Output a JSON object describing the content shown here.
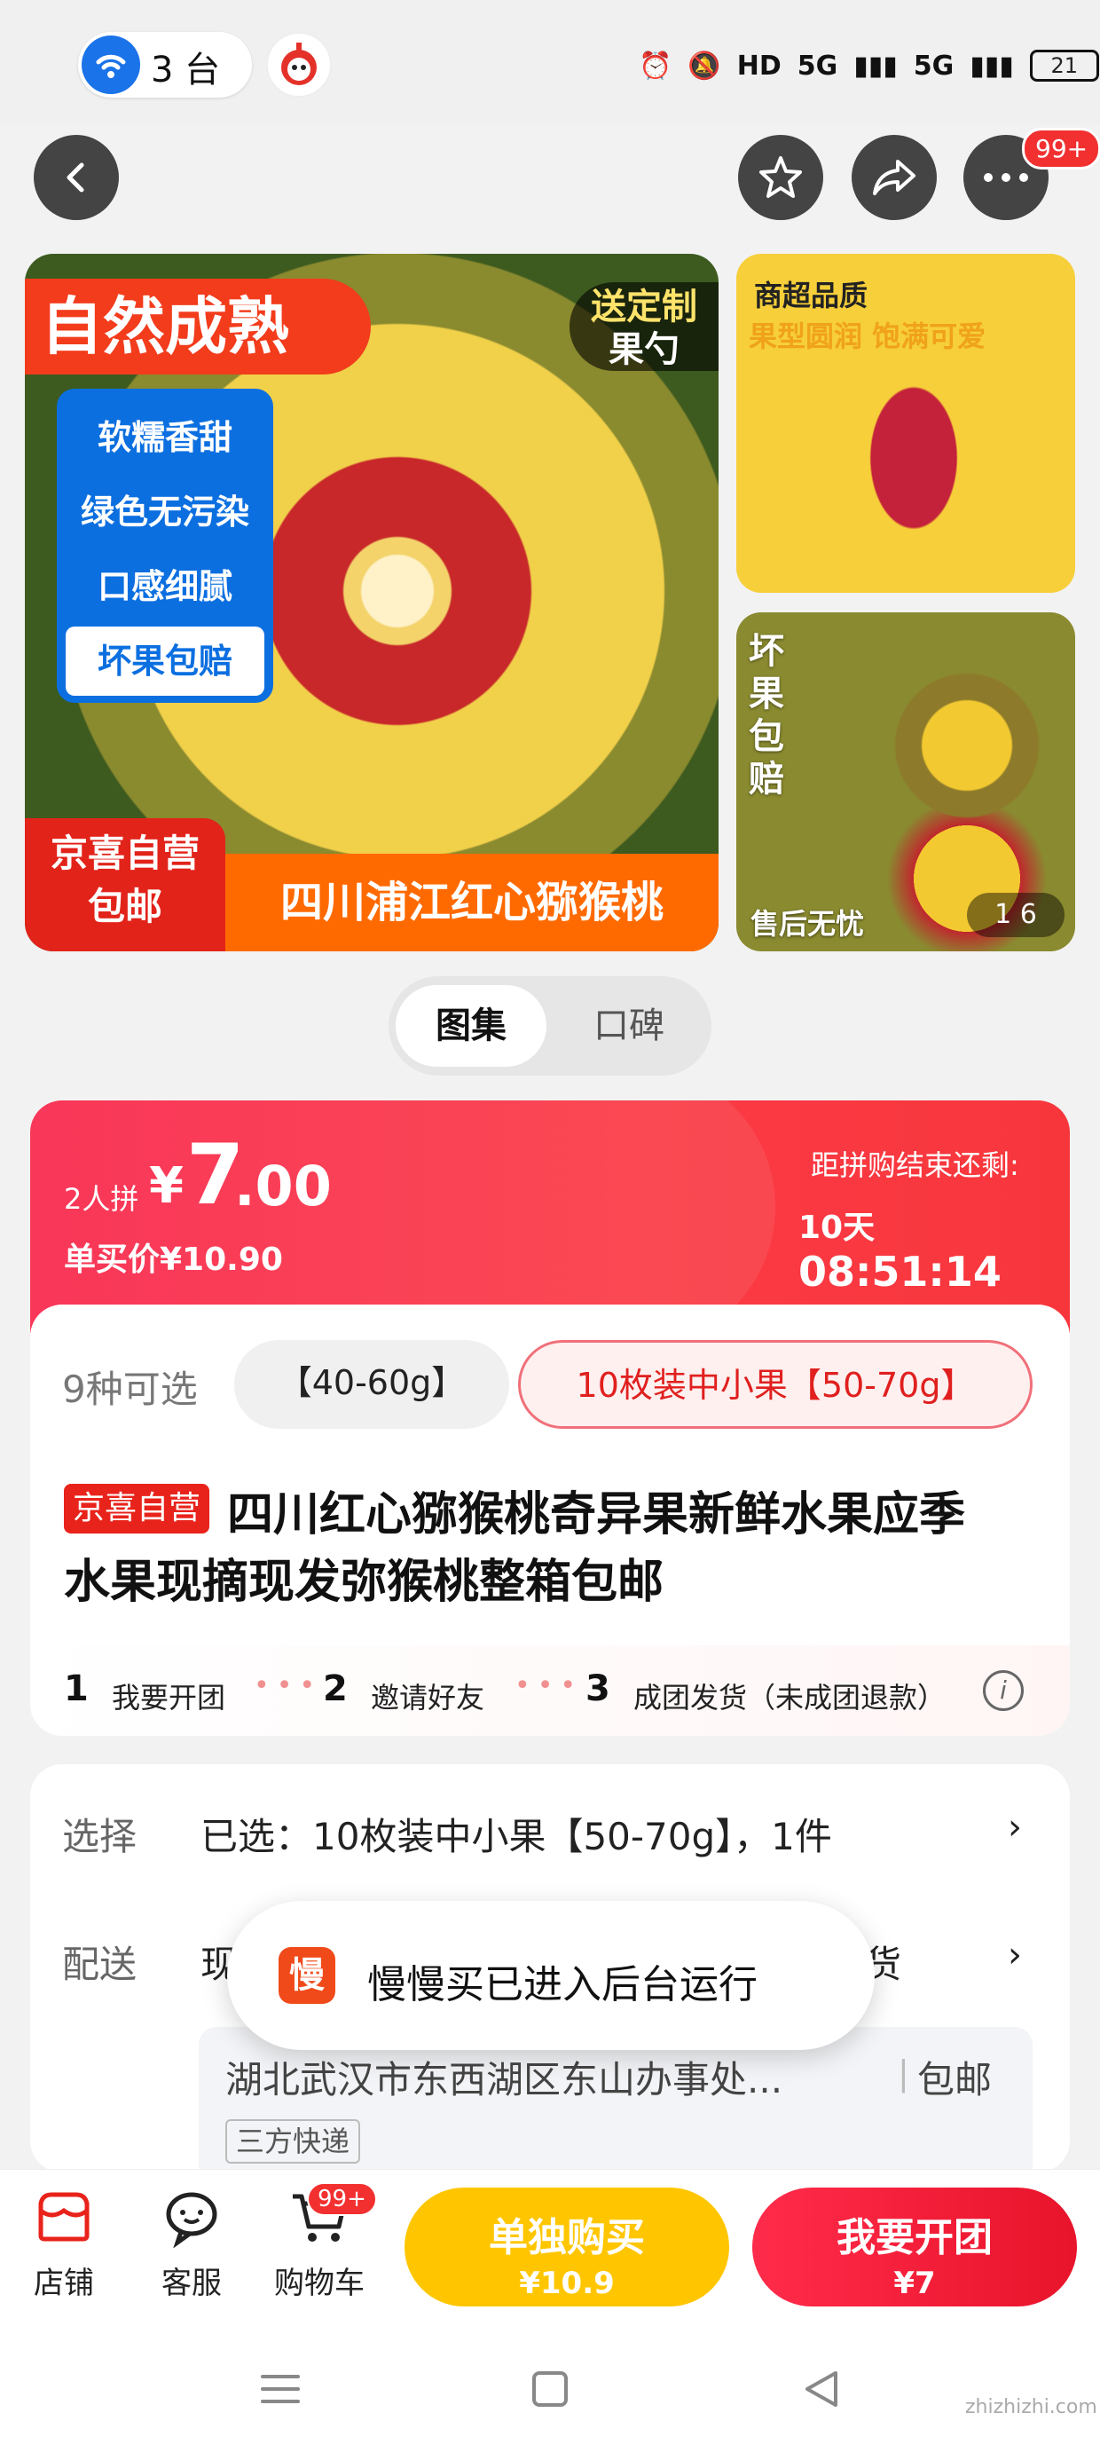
{
  "status_bar": {
    "hotspot_count": "3 台",
    "network_labels": [
      "HD",
      "5G",
      "5G"
    ],
    "battery": "21"
  },
  "nav": {
    "notification_badge": "99+"
  },
  "gallery": {
    "main": {
      "tag_natural": "自然成熟",
      "tag_gift_line1": "送定制",
      "tag_gift_line2": "果勺",
      "benefits": [
        "软糯香甜",
        "绿色无污染",
        "口感细腻",
        "坏果包赔"
      ],
      "tag_self_line1": "京喜自营",
      "tag_self_line2": "包邮",
      "product_tag": "四川浦江红心猕猴桃"
    },
    "side1": {
      "title": "商超品质",
      "subtitle": "果型圆润 饱满可爱"
    },
    "side2": {
      "vertical_text": "坏果包赔",
      "bottom_text": "售后无忧",
      "counter": "1  6"
    }
  },
  "tabs": [
    "图集",
    "口碑"
  ],
  "price": {
    "group_label": "2人拼",
    "currency": "¥",
    "price_int": "7",
    "price_dec": ".00",
    "single_price": "单买价¥10.90",
    "countdown_label": "距拼购结束还剩:",
    "countdown_days": "10天",
    "countdown_time": "08:51:14"
  },
  "variants": {
    "count_label": "9种可选",
    "options": [
      "【40-60g】",
      "10枚装中小果【50-70g】"
    ]
  },
  "product": {
    "badge": "京喜自营",
    "title_line1": "四川红心猕猴桃奇异果新鲜水果应季",
    "title_line2": "水果现摘现发弥猴桃整箱包邮"
  },
  "steps": [
    {
      "num": "1",
      "label": "我要开团"
    },
    {
      "num": "2",
      "label": "邀请好友"
    },
    {
      "num": "3",
      "label": "成团发货（未成团退款）"
    }
  ],
  "selection": {
    "select_label": "选择",
    "select_value": "已选：10枚装中小果【50-70g】，1件",
    "delivery_label": "配送",
    "delivery_prefix": "现",
    "delivery_suffix": "货",
    "address": "湖北武汉市东西湖区东山办事处...",
    "shipping": "包邮",
    "express": "三方快递"
  },
  "toast": {
    "icon_text": "慢",
    "message": "慢慢买已进入后台运行"
  },
  "bottom_bar": {
    "shop": "店铺",
    "service": "客服",
    "cart": "购物车",
    "cart_badge": "99+",
    "single_buy": "单独购买",
    "single_price": "¥10.9",
    "group_buy": "我要开团",
    "group_price": "¥7"
  },
  "watermark": "zhizhizhi.com",
  "colors": {
    "accent_red": "#f9264b",
    "yellow": "#ffc600",
    "self_red": "#e8231b"
  }
}
